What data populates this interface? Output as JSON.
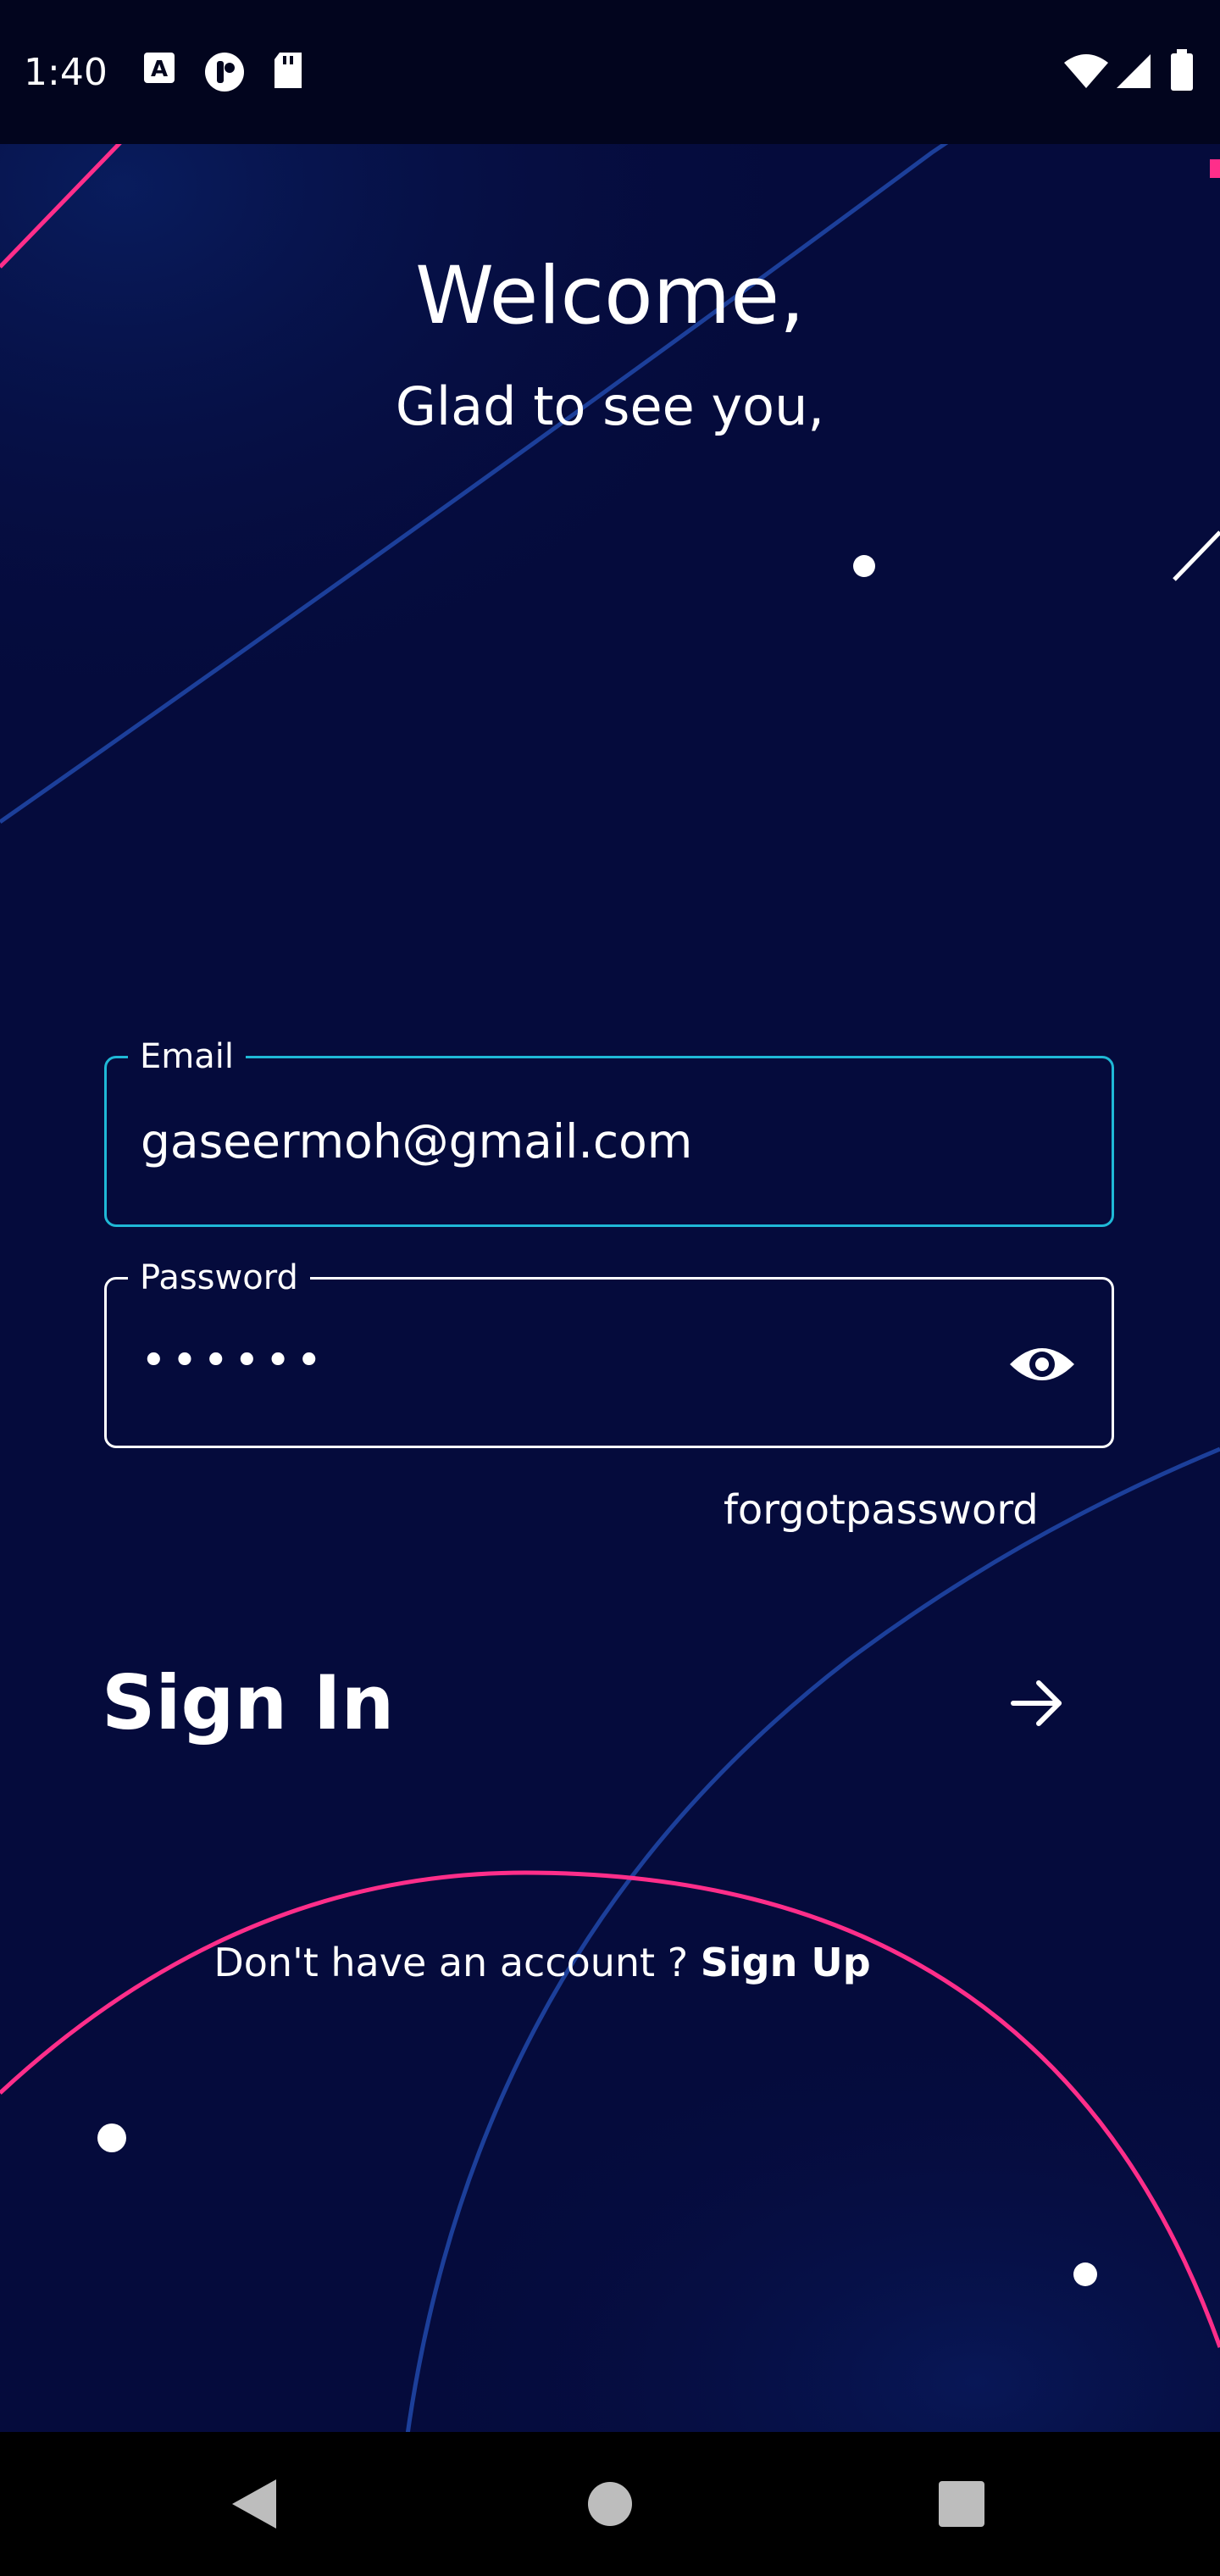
{
  "status_bar": {
    "time": "1:40",
    "left_icons": [
      "font-a-icon",
      "podcast-icon",
      "sd-card-icon"
    ],
    "right_icons": [
      "wifi-icon",
      "signal-icon",
      "battery-icon"
    ]
  },
  "header": {
    "title": "Welcome,",
    "subtitle": "Glad to see you,"
  },
  "form": {
    "email": {
      "label": "Email",
      "value": "gaseermoh@gmail.com"
    },
    "password": {
      "label": "Password",
      "masked_value": "••••••",
      "toggle_icon": "eye-icon"
    },
    "forgot_password": "forgotpassword",
    "sign_in_label": "Sign In",
    "sign_in_icon": "arrow-right-icon"
  },
  "footer": {
    "prompt": "Don't have an account ? ",
    "sign_up": "Sign Up"
  },
  "nav_bar": {
    "buttons": [
      "back-icon",
      "home-icon",
      "recents-icon"
    ]
  },
  "colors": {
    "background": "#050b3c",
    "accent_pink": "#ff2e8a",
    "accent_cyan": "#1fb8d6",
    "accent_blue": "#1c3f9a"
  }
}
